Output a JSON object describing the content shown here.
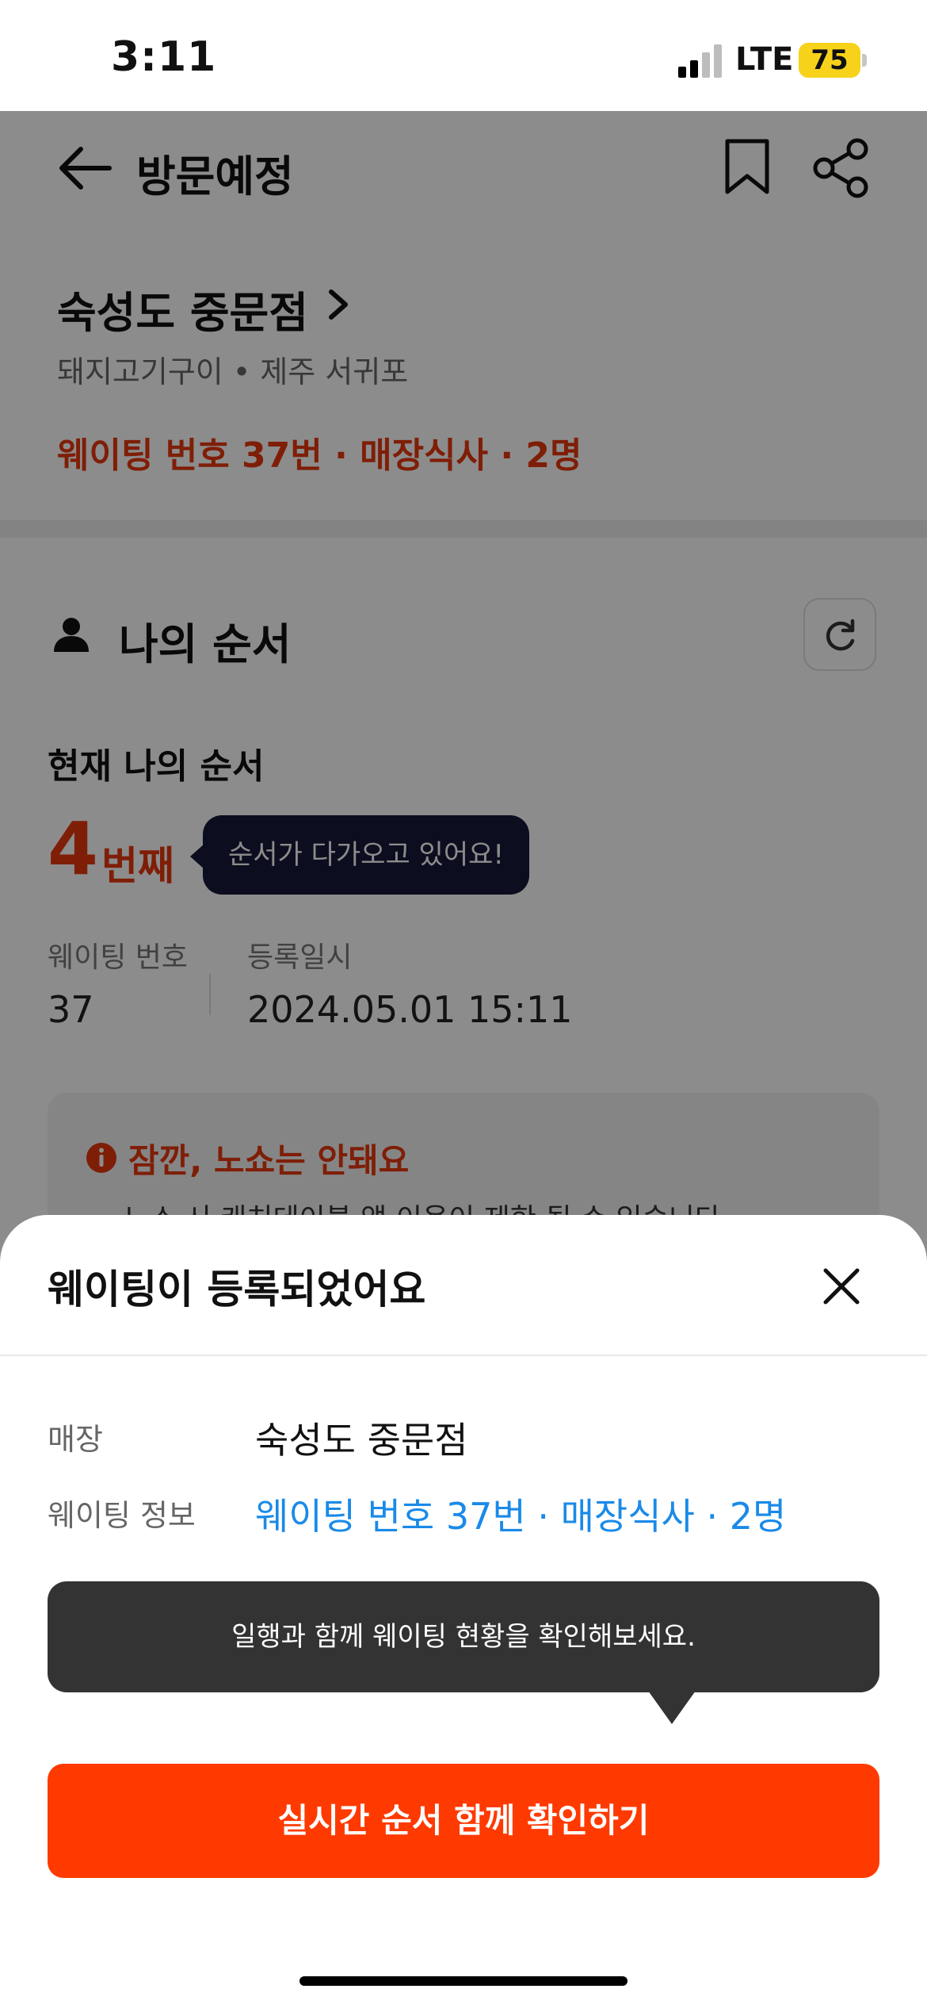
{
  "status_bar": {
    "time": "3:11",
    "network": "LTE",
    "battery": "75"
  },
  "header": {
    "back_icon": "arrow-left-icon",
    "title": "방문예정",
    "bookmark_icon": "bookmark-icon",
    "share_icon": "share-icon"
  },
  "store": {
    "name": "숙성도 중문점",
    "meta": "돼지고기구이 • 제주 서귀포",
    "waiting_summary": "웨이팅 번호 37번 · 매장식사 · 2명"
  },
  "my_order": {
    "title": "나의 순서",
    "current_label": "현재 나의 순서",
    "number": "4",
    "unit": "번째",
    "tooltip": "순서가 다가오고 있어요!",
    "waiting_number_label": "웨이팅 번호",
    "waiting_number_value": "37",
    "registered_label": "등록일시",
    "registered_value": "2024.05.01 15:11"
  },
  "notice": {
    "title": "잠깐, 노쇼는 안돼요",
    "body": "노쇼 시 캐치테이블 앱 이용이 제한 될 수 있습니다"
  },
  "sheet": {
    "title": "웨이팅이 등록되었어요",
    "store_label": "매장",
    "store_value": "숙성도 중문점",
    "waiting_label": "웨이팅 정보",
    "waiting_value": "웨이팅 번호 37번 · 매장식사 · 2명",
    "tooltip": "일행과 함께 웨이팅 현황을 확인해보세요.",
    "cta": "실시간 순서 함께 확인하기"
  },
  "colors": {
    "accent_red": "#e8380d",
    "cta_orange": "#ff3a00",
    "link_blue": "#1a8ae8",
    "tooltip_navy": "#17193a"
  }
}
